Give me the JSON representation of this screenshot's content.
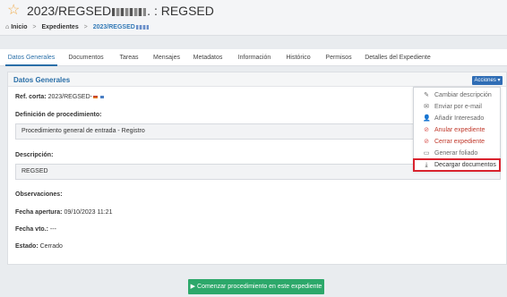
{
  "header": {
    "title_prefix": "2023/REGSED",
    "title_suffix": ". : REGSED",
    "breadcrumb": {
      "home": "Inicio",
      "section": "Expedientes",
      "current": "2023/REGSED"
    }
  },
  "tabs": [
    {
      "label": "Datos Generales",
      "active": true
    },
    {
      "label": "Documentos"
    },
    {
      "label": "Tareas"
    },
    {
      "label": "Mensajes"
    },
    {
      "label": "Metadatos"
    },
    {
      "label": "Información"
    },
    {
      "label": "Histórico"
    },
    {
      "label": "Permisos"
    },
    {
      "label": "Detalles del Expediente"
    }
  ],
  "panel": {
    "title": "Datos Generales",
    "actions_label": "Acciones ▾",
    "ref_label": "Ref. corta:",
    "ref_value": "2023/REGSED-",
    "def_label": "Definición de procedimiento:",
    "def_value": "Procedimiento general de entrada - Registro",
    "desc_label": "Descripción:",
    "desc_value": "REGSED",
    "obs_label": "Observaciones:",
    "apertura_label": "Fecha apertura:",
    "apertura_value": "09/10/2023 11:21",
    "vto_label": "Fecha vto.:",
    "vto_value": "---",
    "estado_label": "Estado:",
    "estado_value": "Cerrado"
  },
  "actions_menu": [
    {
      "label": "Cambiar descripción",
      "icon": "pencil-icon"
    },
    {
      "label": "Enviar por e-mail",
      "icon": "envelope-icon"
    },
    {
      "label": "Añadir Interesado",
      "icon": "user-plus-icon"
    },
    {
      "label": "Anular expediente",
      "icon": "ban-icon",
      "danger": true
    },
    {
      "label": "Cerrar expediente",
      "icon": "ban-icon",
      "danger": true
    },
    {
      "label": "Generar foliado",
      "icon": "file-icon"
    },
    {
      "label": "Decargar documentos",
      "icon": "download-icon",
      "highlighted": true
    }
  ],
  "footer": {
    "start_button": "Comenzar procedimiento en este expediente"
  },
  "colors": {
    "accent": "#2a6fa8",
    "action_button": "#2f6db5",
    "danger": "#c0392b",
    "success": "#2ca86a",
    "highlight_border": "#d9232e"
  }
}
